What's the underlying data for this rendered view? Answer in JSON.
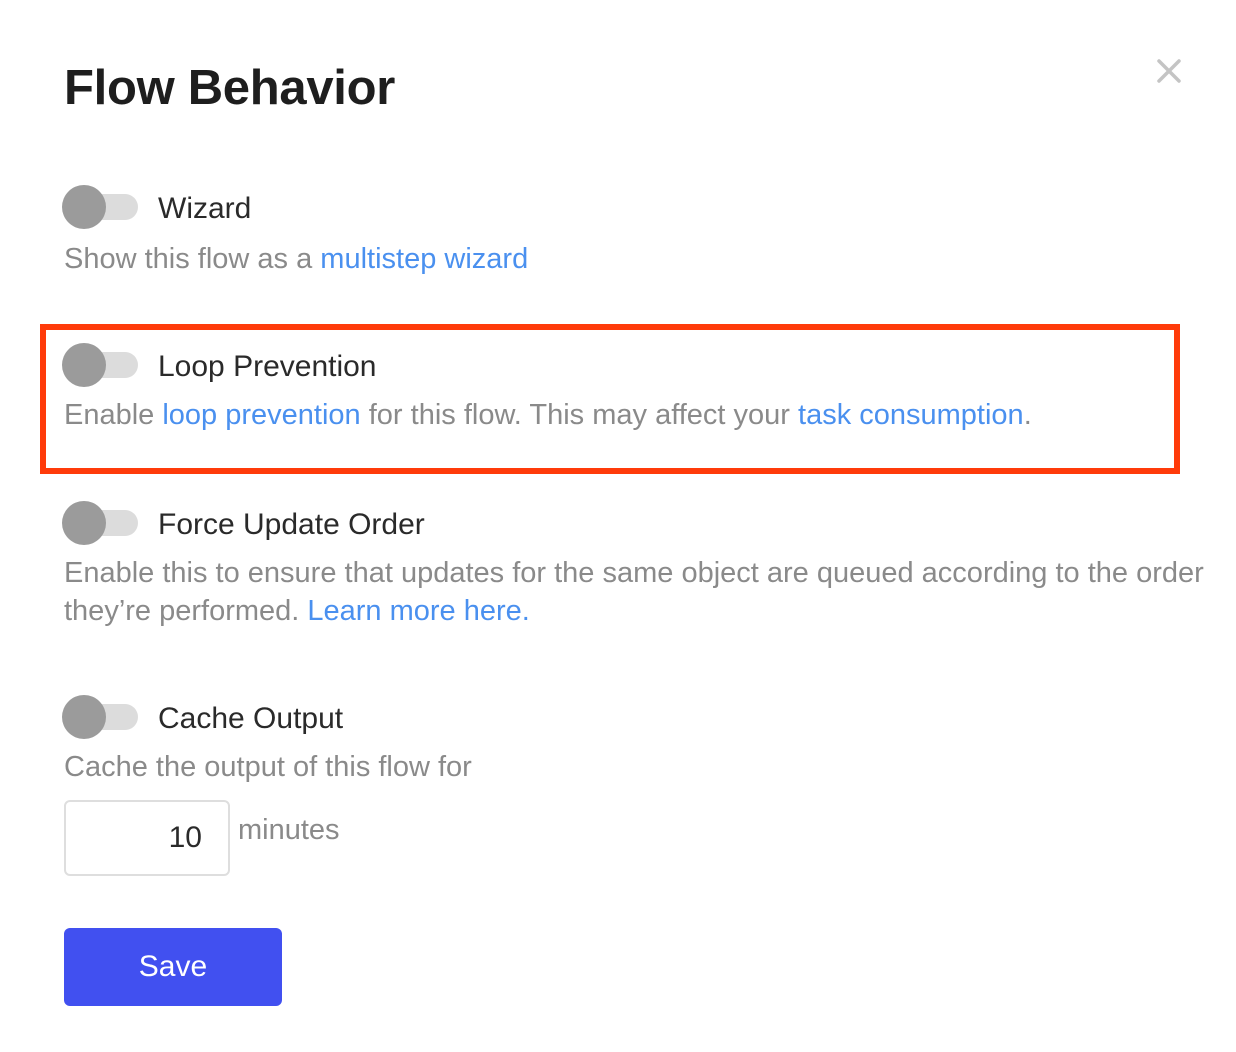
{
  "dialog": {
    "title": "Flow Behavior",
    "close_icon": "close-icon"
  },
  "settings": {
    "wizard": {
      "label": "Wizard",
      "enabled": false,
      "desc_prefix": "Show this flow as a ",
      "desc_link": "multistep wizard"
    },
    "loop_prevention": {
      "label": "Loop Prevention",
      "enabled": false,
      "desc_prefix": "Enable ",
      "desc_link1": "loop prevention",
      "desc_middle": " for this flow. This may affect your ",
      "desc_link2": "task consumption",
      "desc_suffix": "."
    },
    "force_update_order": {
      "label": "Force Update Order",
      "enabled": false,
      "desc_prefix": "Enable this to ensure that updates for the same object are queued according to the order they’re performed. ",
      "desc_link": "Learn more here."
    },
    "cache_output": {
      "label": "Cache Output",
      "enabled": false,
      "desc": "Cache the output of this flow for",
      "minutes_value": "10",
      "minutes_unit": "minutes"
    }
  },
  "actions": {
    "save_label": "Save"
  },
  "colors": {
    "accent": "#4150f0",
    "link": "#4a90ef",
    "highlight": "#ff3b0a"
  }
}
